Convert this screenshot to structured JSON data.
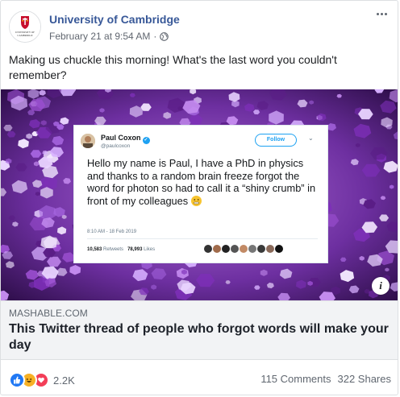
{
  "post": {
    "page_name": "University of Cambridge",
    "timestamp": "February 21 at 9:54 AM",
    "separator": "·",
    "privacy_icon": "globe-icon",
    "more_icon": "more-options-icon",
    "text": "Making us chuckle this morning! What's the last word you couldn't remember?"
  },
  "logo": {
    "text_line1": "UNIVERSITY OF",
    "text_line2": "CAMBRIDGE"
  },
  "tweet": {
    "name": "Paul Coxon",
    "handle": "@paulcoxon",
    "follow_label": "Follow",
    "body": "Hello my name is Paul, I have a PhD in physics and thanks to a random brain freeze forgot the word for photon so had to call it a “shiny crumb” in front of my colleagues",
    "time": "8:10 AM - 18 Feb 2019",
    "retweets_count": "10,583",
    "retweets_label": "Retweets",
    "likes_count": "78,993",
    "likes_label": "Likes"
  },
  "link": {
    "domain": "MASHABLE.COM",
    "headline": "This Twitter thread of people who forgot words will make your day"
  },
  "footer": {
    "reaction_count": "2.2K",
    "comments": "115 Comments",
    "shares": "322 Shares"
  },
  "colors": {
    "link_blue": "#385898",
    "like_blue": "#2078f4",
    "love_red": "#f33e58",
    "haha_yellow": "#f7b125",
    "twitter_blue": "#1da1f2"
  }
}
